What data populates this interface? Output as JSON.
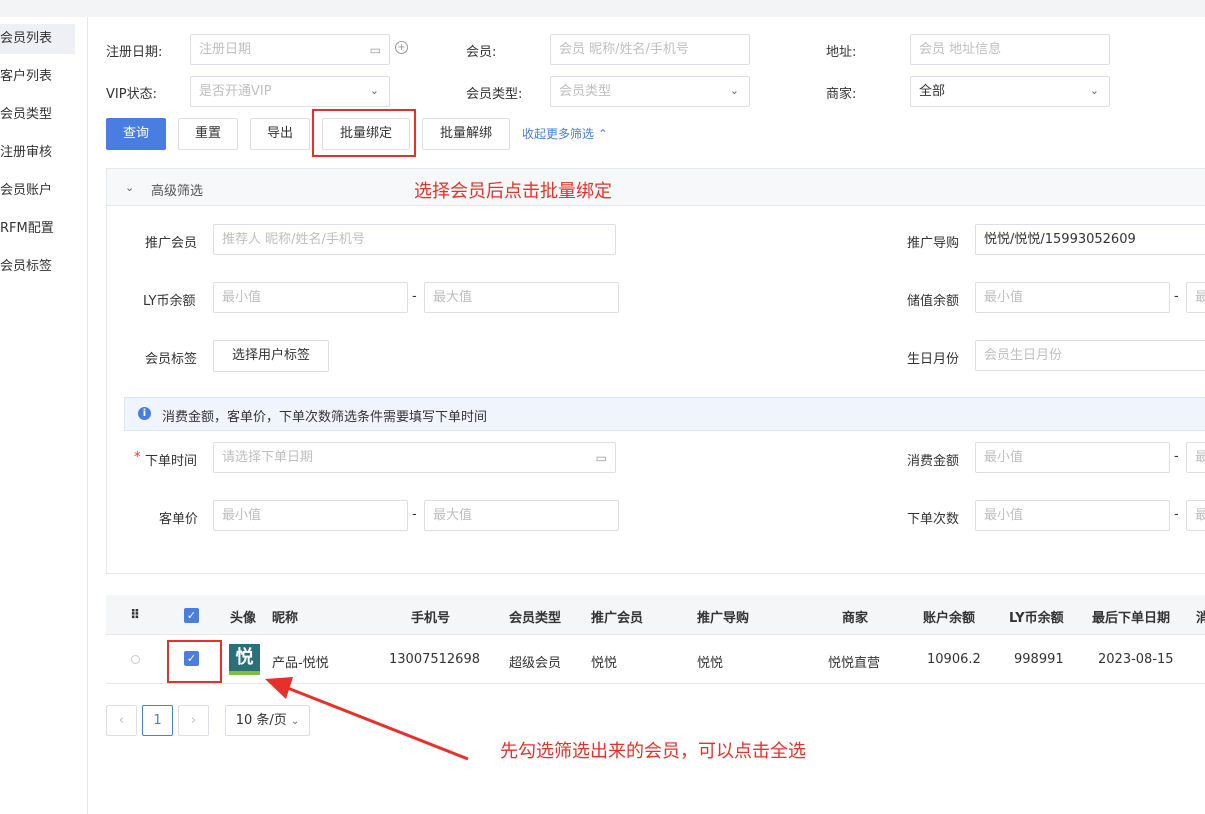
{
  "sidebar": {
    "items": [
      {
        "label": "会员列表"
      },
      {
        "label": "客户列表"
      },
      {
        "label": "会员类型"
      },
      {
        "label": "注册审核"
      },
      {
        "label": "会员账户"
      },
      {
        "label": "RFM配置"
      },
      {
        "label": "会员标签"
      }
    ]
  },
  "filters": {
    "reg_date_label": "注册日期:",
    "reg_date_placeholder": "注册日期",
    "member_label": "会员:",
    "member_placeholder": "会员 昵称/姓名/手机号",
    "address_label": "地址:",
    "address_placeholder": "会员 地址信息",
    "vip_label": "VIP状态:",
    "vip_placeholder": "是否开通VIP",
    "member_type_label": "会员类型:",
    "member_type_placeholder": "会员类型",
    "merchant_label": "商家:",
    "merchant_value": "全部"
  },
  "actions": {
    "query": "查询",
    "reset": "重置",
    "export": "导出",
    "bulk_bind": "批量绑定",
    "bulk_unbind": "批量解绑",
    "collapse": "收起更多筛选"
  },
  "advanced": {
    "title": "高级筛选",
    "promoter_label": "推广会员",
    "promoter_placeholder": "推荐人 昵称/姓名/手机号",
    "guide_label": "推广导购",
    "guide_value": "悦悦/悦悦/15993052609",
    "ly_label": "LY币余额",
    "min_placeholder": "最小值",
    "max_placeholder": "最大值",
    "max_trunc": "最",
    "dash": "-",
    "stored_label": "储值余额",
    "tag_label": "会员标签",
    "tag_button": "选择用户标签",
    "birthday_label": "生日月份",
    "birthday_placeholder": "会员生日月份",
    "info_text": "消费金额，客单价，下单次数筛选条件需要填写下单时间",
    "required_star": "*",
    "order_time_label": "下单时间",
    "order_time_placeholder": "请选择下单日期",
    "spend_label": "消费金额",
    "avg_label": "客单价",
    "count_label": "下单次数"
  },
  "annotations": {
    "bind_hint": "选择会员后点击批量绑定",
    "select_hint": "先勾选筛选出来的会员，可以点击全选"
  },
  "table": {
    "headers": [
      "头像",
      "昵称",
      "手机号",
      "会员类型",
      "推广会员",
      "推广导购",
      "商家",
      "账户余额",
      "LY币余额",
      "最后下单日期",
      "消"
    ],
    "rows": [
      {
        "avatar_text": "悦",
        "nickname": "产品-悦悦",
        "phone": "13007512698",
        "type": "超级会员",
        "promoter": "悦悦",
        "guide": "悦悦",
        "merchant": "悦悦直营",
        "balance": "10906.2",
        "ly": "998991",
        "last_order": "2023-08-15"
      }
    ]
  },
  "pagination": {
    "prev": "‹",
    "current": "1",
    "next": "›",
    "page_size": "10 条/页"
  },
  "colors": {
    "primary": "#4a7de0",
    "annotation": "#e8302a"
  }
}
